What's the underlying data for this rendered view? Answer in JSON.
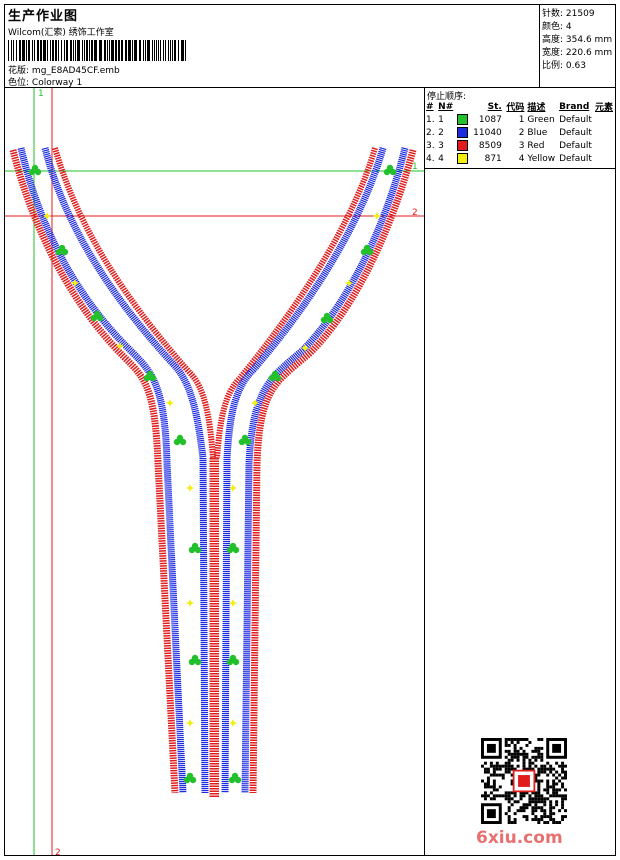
{
  "header": {
    "title": "生产作业图",
    "subtitle": "Wilcom(汇索) 绣饰工作室",
    "design_label": "花版:",
    "design_value": "mg_E8AD45CF.emb",
    "colorway_label": "色位:",
    "colorway_value": "Colorway 1"
  },
  "stats": [
    {
      "label": "针数:",
      "value": "21509"
    },
    {
      "label": "颜色:",
      "value": "4"
    },
    {
      "label": "高度:",
      "value": "354.6 mm"
    },
    {
      "label": "宽度:",
      "value": "220.6 mm"
    },
    {
      "label": "比例:",
      "value": "0.63"
    }
  ],
  "stop_sequence": {
    "title": "停止顺序:",
    "headers": [
      "#",
      "N#",
      "St.",
      "代码",
      "描述",
      "Brand",
      "元素"
    ],
    "rows": [
      {
        "idx": "1.",
        "n": "1",
        "color": "#22c02a",
        "st": "1087",
        "code": "1",
        "desc": "Green",
        "brand": "Default"
      },
      {
        "idx": "2.",
        "n": "2",
        "color": "#1c2ae0",
        "st": "11040",
        "code": "2",
        "desc": "Blue",
        "brand": "Default"
      },
      {
        "idx": "3.",
        "n": "3",
        "color": "#e01c1c",
        "st": "8509",
        "code": "3",
        "desc": "Red",
        "brand": "Default"
      },
      {
        "idx": "4.",
        "n": "4",
        "color": "#f2ee10",
        "st": "871",
        "code": "4",
        "desc": "Yellow",
        "brand": "Default"
      }
    ]
  },
  "guides": {
    "v1_label": "1",
    "v2_label": "2",
    "h1_label": "1",
    "h2_label": "2"
  },
  "colors": {
    "green": "#22c02a",
    "blue": "#1c2ae0",
    "red": "#e01c1c",
    "yellow": "#f2ee10"
  },
  "watermark": "6xiu.com"
}
